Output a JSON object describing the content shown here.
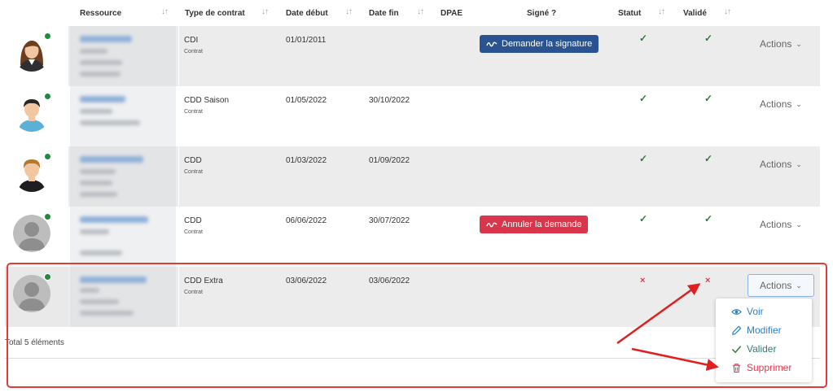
{
  "columns": {
    "ressource": "Ressource",
    "type_contrat": "Type de contrat",
    "date_debut": "Date début",
    "date_fin": "Date fin",
    "dpae": "DPAE",
    "signe": "Signé ?",
    "statut": "Statut",
    "valide": "Validé"
  },
  "icons": {
    "sort": "sort-arrows-icon",
    "check": "checkmark-icon",
    "cross": "cross-icon",
    "chevron": "chevron-down-icon",
    "signature": "signature-icon"
  },
  "colors": {
    "sign_button": "#2a5491",
    "cancel_button": "#d9354b",
    "status_ok": "#2e7d32",
    "status_ko": "#e0394f",
    "online_dot": "#1e8c3a",
    "highlight": "#e23a3a"
  },
  "rows": [
    {
      "type": "CDI",
      "sub": "Contrat",
      "start": "01/01/2011",
      "end": "",
      "sign_label": "Demander la signature",
      "statut": "✓",
      "valide": "✓",
      "actions": "Actions",
      "avatar": "woman"
    },
    {
      "type": "CDD Saison",
      "sub": "Contrat",
      "start": "01/05/2022",
      "end": "30/10/2022",
      "sign_label": "",
      "statut": "✓",
      "valide": "✓",
      "actions": "Actions",
      "avatar": "man-dark"
    },
    {
      "type": "CDD",
      "sub": "Contrat",
      "start": "01/03/2022",
      "end": "01/09/2022",
      "sign_label": "",
      "statut": "✓",
      "valide": "✓",
      "actions": "Actions",
      "avatar": "man-blond"
    },
    {
      "type": "CDD",
      "sub": "Contrat",
      "start": "06/06/2022",
      "end": "30/07/2022",
      "sign_label": "Annuler la demande",
      "statut": "✓",
      "valide": "✓",
      "actions": "Actions",
      "avatar": "placeholder"
    },
    {
      "type": "CDD Extra",
      "sub": "Contrat",
      "start": "03/06/2022",
      "end": "03/06/2022",
      "sign_label": "",
      "statut": "×",
      "valide": "×",
      "actions": "Actions",
      "avatar": "placeholder"
    }
  ],
  "footer": {
    "total": "Total 5 éléments"
  },
  "menu": {
    "voir": "Voir",
    "modifier": "Modifier",
    "valider": "Valider",
    "supprimer": "Supprimer"
  }
}
